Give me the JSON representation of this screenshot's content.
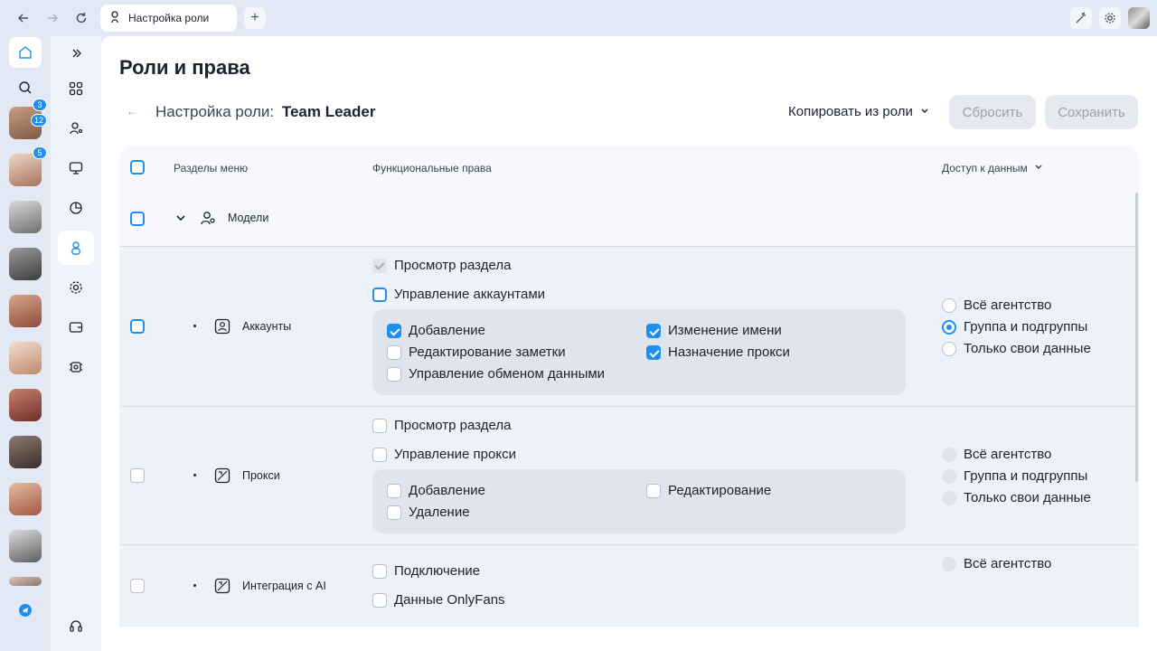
{
  "browser": {
    "tab_title": "Настройка роли"
  },
  "page": {
    "title": "Роли и права",
    "role_label": "Настройка роли:",
    "role_name": "Team Leader",
    "copy_from_role": "Копировать из роли",
    "reset": "Сбросить",
    "save": "Сохранить"
  },
  "rail": {
    "badges": [
      "3",
      "12",
      "5"
    ]
  },
  "table": {
    "headers": {
      "menu_sections": "Разделы меню",
      "functional_rights": "Функциональные права",
      "data_access": "Доступ к данным"
    },
    "group": {
      "name": "Модели"
    },
    "rows": [
      {
        "name": "Аккаунты",
        "view": "Просмотр раздела",
        "manage": "Управление аккаунтами",
        "perms": [
          "Добавление",
          "Изменение имени",
          "Редактирование заметки",
          "Назначение прокси",
          "Управление обменом данными"
        ],
        "access": [
          "Всё агентство",
          "Группа и подгруппы",
          "Только свои данные"
        ]
      },
      {
        "name": "Прокси",
        "view": "Просмотр раздела",
        "manage": "Управление прокси",
        "perms": [
          "Добавление",
          "Редактирование",
          "Удаление"
        ],
        "access": [
          "Всё агентство",
          "Группа и подгруппы",
          "Только свои данные"
        ]
      },
      {
        "name": "Интеграция с AI",
        "perms": [
          "Подключение",
          "Данные OnlyFans"
        ],
        "access": [
          "Всё агентство"
        ]
      }
    ]
  },
  "colors": {
    "accent": "#1f8ef1",
    "row_bg": "#edf1f8",
    "subbox_bg": "#dfe4ed"
  }
}
